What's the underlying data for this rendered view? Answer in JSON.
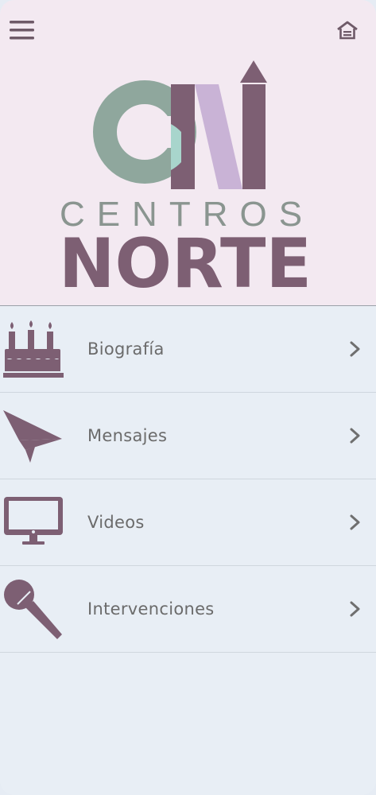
{
  "header": {
    "menu_icon": "hamburger-menu-icon",
    "home_icon": "home-icon",
    "logo": {
      "monogram": "CN",
      "line1": "CENTROS",
      "line2": "NORTE",
      "colors": {
        "mauve": "#7d5f73",
        "sage": "#8fa79d",
        "mint": "#a8d5cc",
        "lilac": "#c9b3d6"
      }
    }
  },
  "menu": {
    "items": [
      {
        "label": "Biografía",
        "icon": "birthday-cake-icon"
      },
      {
        "label": "Mensajes",
        "icon": "paper-plane-icon"
      },
      {
        "label": "Videos",
        "icon": "monitor-icon"
      },
      {
        "label": "Intervenciones",
        "icon": "microphone-icon"
      }
    ],
    "chevron_icon": "chevron-right-icon"
  },
  "colors": {
    "header_bg": "#f3e9f1",
    "list_bg": "#e8eef5",
    "icon": "#7d5f73",
    "text": "#6b6b6b"
  }
}
